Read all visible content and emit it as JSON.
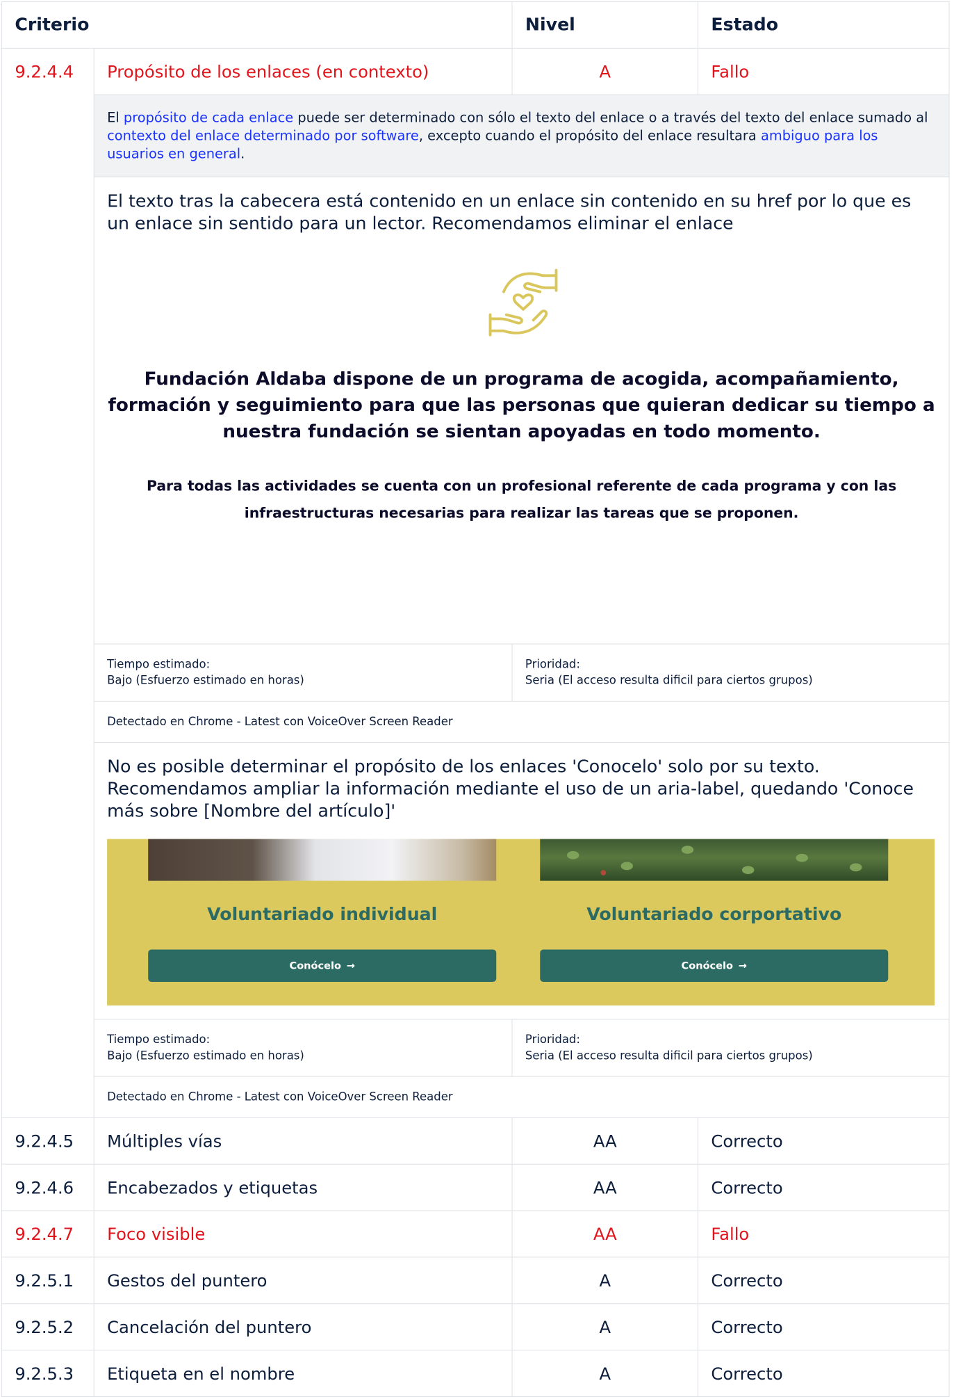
{
  "table": {
    "headers": {
      "criterio": "Criterio",
      "nivel": "Nivel",
      "estado": "Estado"
    },
    "expanded_row": {
      "id": "9.2.4.4",
      "name": "Propósito de los enlaces (en contexto)",
      "level": "A",
      "status": "Fallo",
      "description": {
        "t1": "El ",
        "l1": "propósito de cada enlace",
        "t2": " puede ser determinado con sólo el texto del enlace o a través del texto del enlace sumado al ",
        "l2": "contexto del enlace determinado por software",
        "t3": ", excepto cuando el propósito del enlace resultara ",
        "l3": "ambiguo para los usuarios en general",
        "t4": "."
      },
      "issues": [
        {
          "text": "El texto tras la cabecera está contenido en un enlace sin contenido en su href por lo que es un enlace sin sentido para un lector. Recomendamos eliminar el enlace",
          "screenshot": {
            "heading": "Fundación Aldaba dispone de un programa de acogida, acompañamiento, formación y seguimiento para que las personas que quieran dedicar su tiempo a nuestra fundación se sientan apoyadas en todo momento.",
            "paragraph": "Para todas las actividades se cuenta con un profesional referente de cada programa y con las infraestructuras necesarias para realizar las tareas que se proponen.",
            "icon": "hands-heart-icon",
            "accent": "#d9c65c"
          },
          "time_label": "Tiempo estimado:",
          "time_value": "Bajo (Esfuerzo estimado en horas)",
          "priority_label": "Prioridad:",
          "priority_value": "Seria (El acceso resulta dificil para ciertos grupos)",
          "detected": "Detectado en Chrome - Latest con VoiceOver Screen Reader"
        },
        {
          "text": "No es posible determinar el propósito de los enlaces 'Conocelo' solo por su texto. Recomendamos ampliar la información mediante el uso de un aria-label, quedando 'Conoce más sobre [Nombre del artículo]'",
          "screenshot": {
            "card1_title": "Voluntariado individual",
            "card2_title": "Voluntariado corportativo",
            "button_label": "Conócelo",
            "button_icon": "arrow-right-icon",
            "background": "#dcc95e",
            "button_color": "#2c6b63"
          },
          "time_label": "Tiempo estimado:",
          "time_value": "Bajo (Esfuerzo estimado en horas)",
          "priority_label": "Prioridad:",
          "priority_value": "Seria (El acceso resulta dificil para ciertos grupos)",
          "detected": "Detectado en Chrome - Latest con VoiceOver Screen Reader"
        }
      ]
    },
    "rows": [
      {
        "id": "9.2.4.5",
        "name": "Múltiples vías",
        "level": "AA",
        "status": "Correcto"
      },
      {
        "id": "9.2.4.6",
        "name": "Encabezados y etiquetas",
        "level": "AA",
        "status": "Correcto"
      },
      {
        "id": "9.2.4.7",
        "name": "Foco visible",
        "level": "AA",
        "status": "Fallo"
      },
      {
        "id": "9.2.5.1",
        "name": "Gestos del puntero",
        "level": "A",
        "status": "Correcto"
      },
      {
        "id": "9.2.5.2",
        "name": "Cancelación del puntero",
        "level": "A",
        "status": "Correcto"
      },
      {
        "id": "9.2.5.3",
        "name": "Etiqueta en el nombre",
        "level": "A",
        "status": "Correcto"
      }
    ],
    "colors": {
      "fail": "#e1141c",
      "text": "#0c1e3c",
      "link": "#1a33ff",
      "description_bg": "#f1f2f4"
    }
  }
}
